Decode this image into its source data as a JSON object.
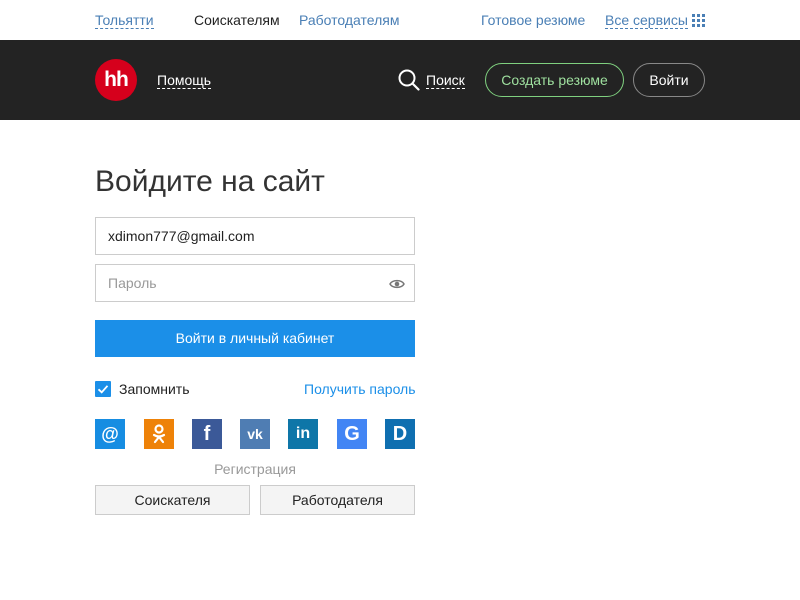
{
  "topbar": {
    "city": "Тольятти",
    "seekers": "Соискателям",
    "employers": "Работодателям",
    "ready_resume": "Готовое резюме",
    "all_services": "Все сервисы"
  },
  "header": {
    "logo_text": "hh",
    "help": "Помощь",
    "search": "Поиск",
    "create_resume": "Создать резюме",
    "login": "Войти"
  },
  "form": {
    "title": "Войдите на сайт",
    "email_value": "xdimon777@gmail.com",
    "password_placeholder": "Пароль",
    "submit": "Войти в личный кабинет",
    "remember": "Запомнить",
    "remember_checked": true,
    "get_password": "Получить пароль"
  },
  "social": [
    {
      "name": "mail-icon",
      "color": "#168de2"
    },
    {
      "name": "odnoklassniki-icon",
      "color": "#ee8208"
    },
    {
      "name": "facebook-icon",
      "color": "#3b5998"
    },
    {
      "name": "vk-icon",
      "color": "#4f7db3"
    },
    {
      "name": "linkedin-icon",
      "color": "#0e76a8"
    },
    {
      "name": "google-icon",
      "color": "#4285f4"
    },
    {
      "name": "d-icon",
      "color": "#0f6fb0"
    }
  ],
  "registration": {
    "label": "Регистрация",
    "seeker": "Соискателя",
    "employer": "Работодателя"
  },
  "colors": {
    "header_bg": "#232323",
    "accent": "#1b8fe8",
    "logo": "#d6001c"
  }
}
